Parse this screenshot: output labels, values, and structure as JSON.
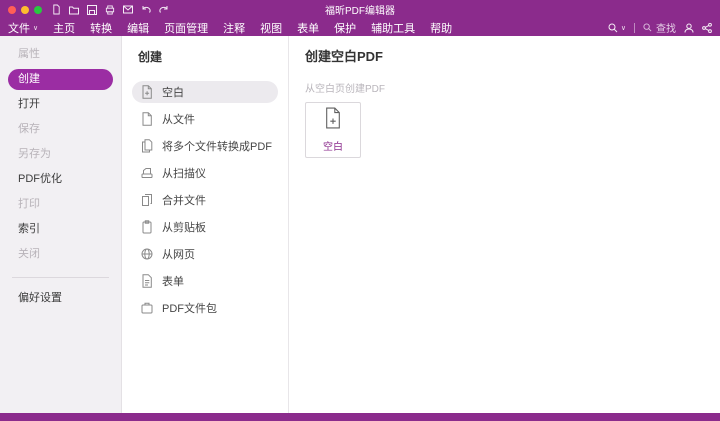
{
  "window": {
    "title": "福昕PDF编辑器"
  },
  "titlebar": {
    "icons": [
      "new-doc-icon",
      "open-folder-icon",
      "save-icon",
      "print-icon",
      "mail-icon",
      "undo-icon",
      "redo-icon"
    ]
  },
  "menubar": {
    "items": [
      "文件",
      "主页",
      "转换",
      "编辑",
      "页面管理",
      "注释",
      "视图",
      "表单",
      "保护",
      "辅助工具",
      "帮助"
    ],
    "search_label": "查找"
  },
  "sidebar": {
    "items": [
      {
        "label": "属性",
        "state": "disabled"
      },
      {
        "label": "创建",
        "state": "selected"
      },
      {
        "label": "打开",
        "state": "normal"
      },
      {
        "label": "保存",
        "state": "disabled"
      },
      {
        "label": "另存为",
        "state": "disabled"
      },
      {
        "label": "PDF优化",
        "state": "normal"
      },
      {
        "label": "打印",
        "state": "disabled"
      },
      {
        "label": "索引",
        "state": "normal"
      },
      {
        "label": "关闭",
        "state": "disabled"
      }
    ],
    "preferences_label": "偏好设置"
  },
  "create_panel": {
    "header": "创建",
    "items": [
      {
        "label": "空白",
        "icon": "blank-page-icon",
        "selected": true
      },
      {
        "label": "从文件",
        "icon": "from-file-icon",
        "selected": false
      },
      {
        "label": "将多个文件转换成PDF",
        "icon": "convert-multiple-icon",
        "selected": false
      },
      {
        "label": "从扫描仪",
        "icon": "scanner-icon",
        "selected": false
      },
      {
        "label": "合并文件",
        "icon": "combine-files-icon",
        "selected": false
      },
      {
        "label": "从剪贴板",
        "icon": "clipboard-icon",
        "selected": false
      },
      {
        "label": "从网页",
        "icon": "web-icon",
        "selected": false
      },
      {
        "label": "表单",
        "icon": "form-icon",
        "selected": false
      },
      {
        "label": "PDF文件包",
        "icon": "portfolio-icon",
        "selected": false
      }
    ]
  },
  "main": {
    "title": "创建空白PDF",
    "subtitle": "从空白页创建PDF",
    "card": {
      "label": "空白",
      "icon": "new-blank-page-icon"
    }
  },
  "colors": {
    "brand_purple": "#8b2b8c",
    "selected_pill_purple": "#9b2da3",
    "selected_item_gray": "#eceaee",
    "traffic_red": "#ff5f57",
    "traffic_yellow": "#febc2e",
    "traffic_green": "#28c840"
  }
}
